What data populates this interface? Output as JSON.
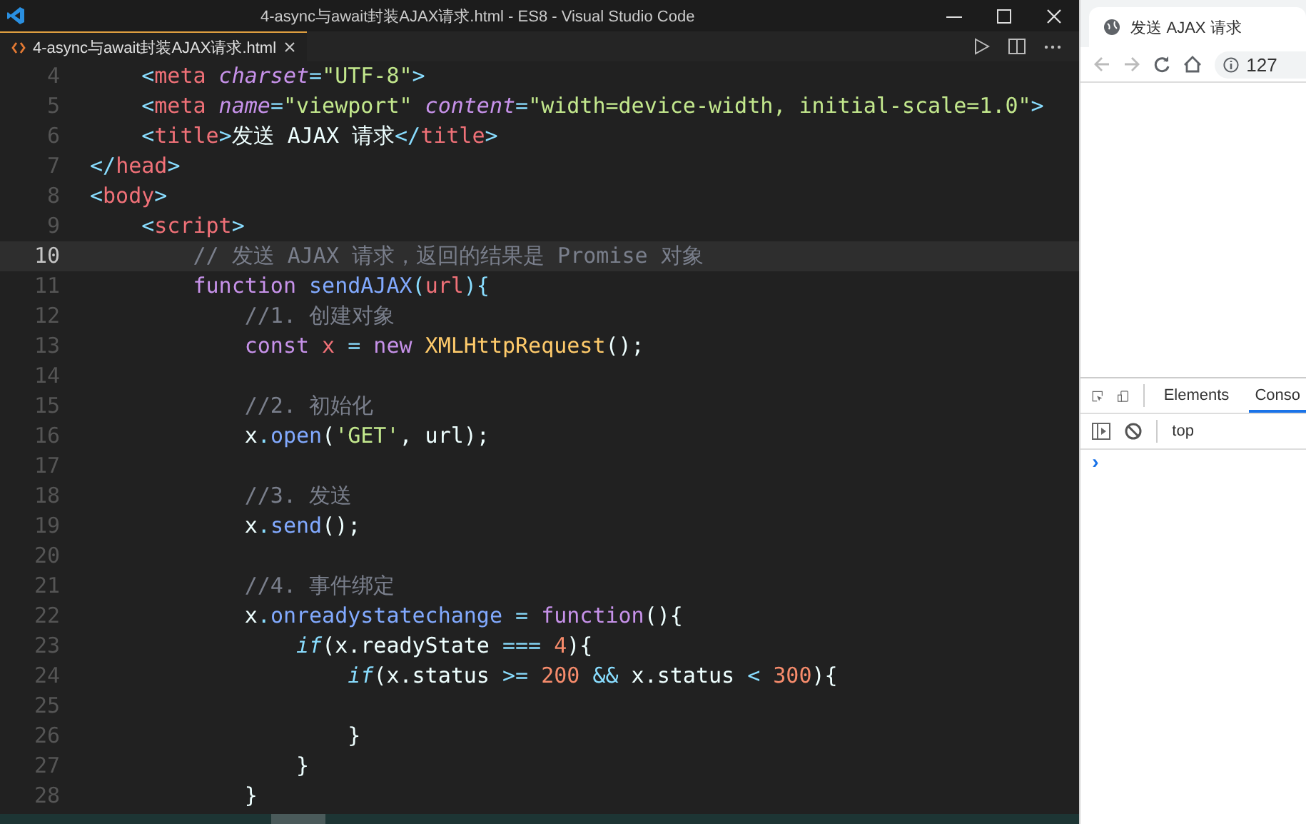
{
  "editor": {
    "title": "4-async与await封装AJAX请求.html - ES8 - Visual Studio Code",
    "tabs": [
      {
        "label": "4-async与await封装AJAX请求.html",
        "selected": true
      }
    ],
    "lines": [
      {
        "number": "4",
        "current": false,
        "tokens": [
          {
            "kind": "punct",
            "text": "    <"
          },
          {
            "kind": "tag",
            "text": "meta"
          },
          {
            "kind": "attr",
            "text": " charset"
          },
          {
            "kind": "punct",
            "text": "="
          },
          {
            "kind": "string",
            "text": "\"UTF-8\""
          },
          {
            "kind": "punct",
            "text": ">"
          }
        ]
      },
      {
        "number": "5",
        "current": false,
        "tokens": [
          {
            "kind": "punct",
            "text": "    <"
          },
          {
            "kind": "tag",
            "text": "meta"
          },
          {
            "kind": "attr",
            "text": " name"
          },
          {
            "kind": "punct",
            "text": "="
          },
          {
            "kind": "string",
            "text": "\"viewport\""
          },
          {
            "kind": "attr",
            "text": " content"
          },
          {
            "kind": "punct",
            "text": "="
          },
          {
            "kind": "string",
            "text": "\"width=device-width, initial-scale=1.0\""
          },
          {
            "kind": "punct",
            "text": ">"
          }
        ]
      },
      {
        "number": "6",
        "current": false,
        "tokens": [
          {
            "kind": "punct",
            "text": "    <"
          },
          {
            "kind": "tag",
            "text": "title"
          },
          {
            "kind": "punct",
            "text": ">"
          },
          {
            "kind": "text",
            "text": "发送 AJAX 请求"
          },
          {
            "kind": "punct",
            "text": "</"
          },
          {
            "kind": "tag",
            "text": "title"
          },
          {
            "kind": "punct",
            "text": ">"
          }
        ]
      },
      {
        "number": "7",
        "current": false,
        "tokens": [
          {
            "kind": "punct",
            "text": "</"
          },
          {
            "kind": "tag",
            "text": "head"
          },
          {
            "kind": "punct",
            "text": ">"
          }
        ]
      },
      {
        "number": "8",
        "current": false,
        "tokens": [
          {
            "kind": "punct",
            "text": "<"
          },
          {
            "kind": "tag",
            "text": "body"
          },
          {
            "kind": "punct",
            "text": ">"
          }
        ]
      },
      {
        "number": "9",
        "current": false,
        "tokens": [
          {
            "kind": "punct",
            "text": "    <"
          },
          {
            "kind": "tag",
            "text": "script"
          },
          {
            "kind": "punct",
            "text": ">"
          }
        ]
      },
      {
        "number": "10",
        "current": true,
        "tokens": [
          {
            "kind": "comment",
            "text": "        // 发送 AJAX 请求，返回的结果是 Promise 对象"
          }
        ]
      },
      {
        "number": "11",
        "current": false,
        "tokens": [
          {
            "kind": "keyword",
            "text": "        function"
          },
          {
            "kind": "func",
            "text": " sendAJAX"
          },
          {
            "kind": "punct",
            "text": "("
          },
          {
            "kind": "var",
            "text": "url"
          },
          {
            "kind": "punct",
            "text": "){"
          }
        ]
      },
      {
        "number": "12",
        "current": false,
        "tokens": [
          {
            "kind": "comment",
            "text": "            //1. 创建对象"
          }
        ]
      },
      {
        "number": "13",
        "current": false,
        "tokens": [
          {
            "kind": "keyword",
            "text": "            const"
          },
          {
            "kind": "var",
            "text": " x"
          },
          {
            "kind": "punct",
            "text": " ="
          },
          {
            "kind": "keyword",
            "text": " new"
          },
          {
            "kind": "class",
            "text": " XMLHttpRequest"
          },
          {
            "kind": "text",
            "text": "();"
          }
        ]
      },
      {
        "number": "14",
        "current": false
      },
      {
        "number": "15",
        "current": false,
        "tokens": [
          {
            "kind": "comment",
            "text": "            //2. 初始化"
          }
        ]
      },
      {
        "number": "16",
        "current": false,
        "tokens": [
          {
            "kind": "text",
            "text": "            x"
          },
          {
            "kind": "punct",
            "text": "."
          },
          {
            "kind": "func",
            "text": "open"
          },
          {
            "kind": "text",
            "text": "("
          },
          {
            "kind": "string",
            "text": "'GET'"
          },
          {
            "kind": "text",
            "text": ", url);"
          }
        ]
      },
      {
        "number": "17",
        "current": false
      },
      {
        "number": "18",
        "current": false,
        "tokens": [
          {
            "kind": "comment",
            "text": "            //3. 发送"
          }
        ]
      },
      {
        "number": "19",
        "current": false,
        "tokens": [
          {
            "kind": "text",
            "text": "            x"
          },
          {
            "kind": "punct",
            "text": "."
          },
          {
            "kind": "func",
            "text": "send"
          },
          {
            "kind": "text",
            "text": "();"
          }
        ]
      },
      {
        "number": "20",
        "current": false
      },
      {
        "number": "21",
        "current": false,
        "tokens": [
          {
            "kind": "comment",
            "text": "            //4. 事件绑定"
          }
        ]
      },
      {
        "number": "22",
        "current": false,
        "tokens": [
          {
            "kind": "text",
            "text": "            x"
          },
          {
            "kind": "punct",
            "text": "."
          },
          {
            "kind": "func",
            "text": "onreadystatechange"
          },
          {
            "kind": "punct",
            "text": " ="
          },
          {
            "kind": "keyword",
            "text": " function"
          },
          {
            "kind": "text",
            "text": "(){"
          }
        ]
      },
      {
        "number": "23",
        "current": false,
        "tokens": [
          {
            "kind": "control",
            "text": "                if"
          },
          {
            "kind": "text",
            "text": "(x.readyState"
          },
          {
            "kind": "punct",
            "text": " ==="
          },
          {
            "kind": "number",
            "text": " 4"
          },
          {
            "kind": "text",
            "text": "){"
          }
        ]
      },
      {
        "number": "24",
        "current": false,
        "tokens": [
          {
            "kind": "control",
            "text": "                    if"
          },
          {
            "kind": "text",
            "text": "(x.status"
          },
          {
            "kind": "punct",
            "text": " >="
          },
          {
            "kind": "number",
            "text": " 200"
          },
          {
            "kind": "punct",
            "text": " &&"
          },
          {
            "kind": "text",
            "text": " x.status"
          },
          {
            "kind": "punct",
            "text": " <"
          },
          {
            "kind": "number",
            "text": " 300"
          },
          {
            "kind": "text",
            "text": "){"
          }
        ]
      },
      {
        "number": "25",
        "current": false
      },
      {
        "number": "26",
        "current": false,
        "tokens": [
          {
            "kind": "text",
            "text": "                    }"
          }
        ]
      },
      {
        "number": "27",
        "current": false,
        "tokens": [
          {
            "kind": "text",
            "text": "                }"
          }
        ]
      },
      {
        "number": "28",
        "current": false,
        "tokens": [
          {
            "kind": "text",
            "text": "            }"
          }
        ]
      }
    ]
  },
  "browser": {
    "tab_title": "发送 AJAX 请求",
    "address": "127",
    "devtools": {
      "tabs": [
        {
          "label": "Elements",
          "selected": false
        },
        {
          "label": "Conso",
          "selected": true
        }
      ],
      "context": "top",
      "prompt": "›"
    }
  }
}
